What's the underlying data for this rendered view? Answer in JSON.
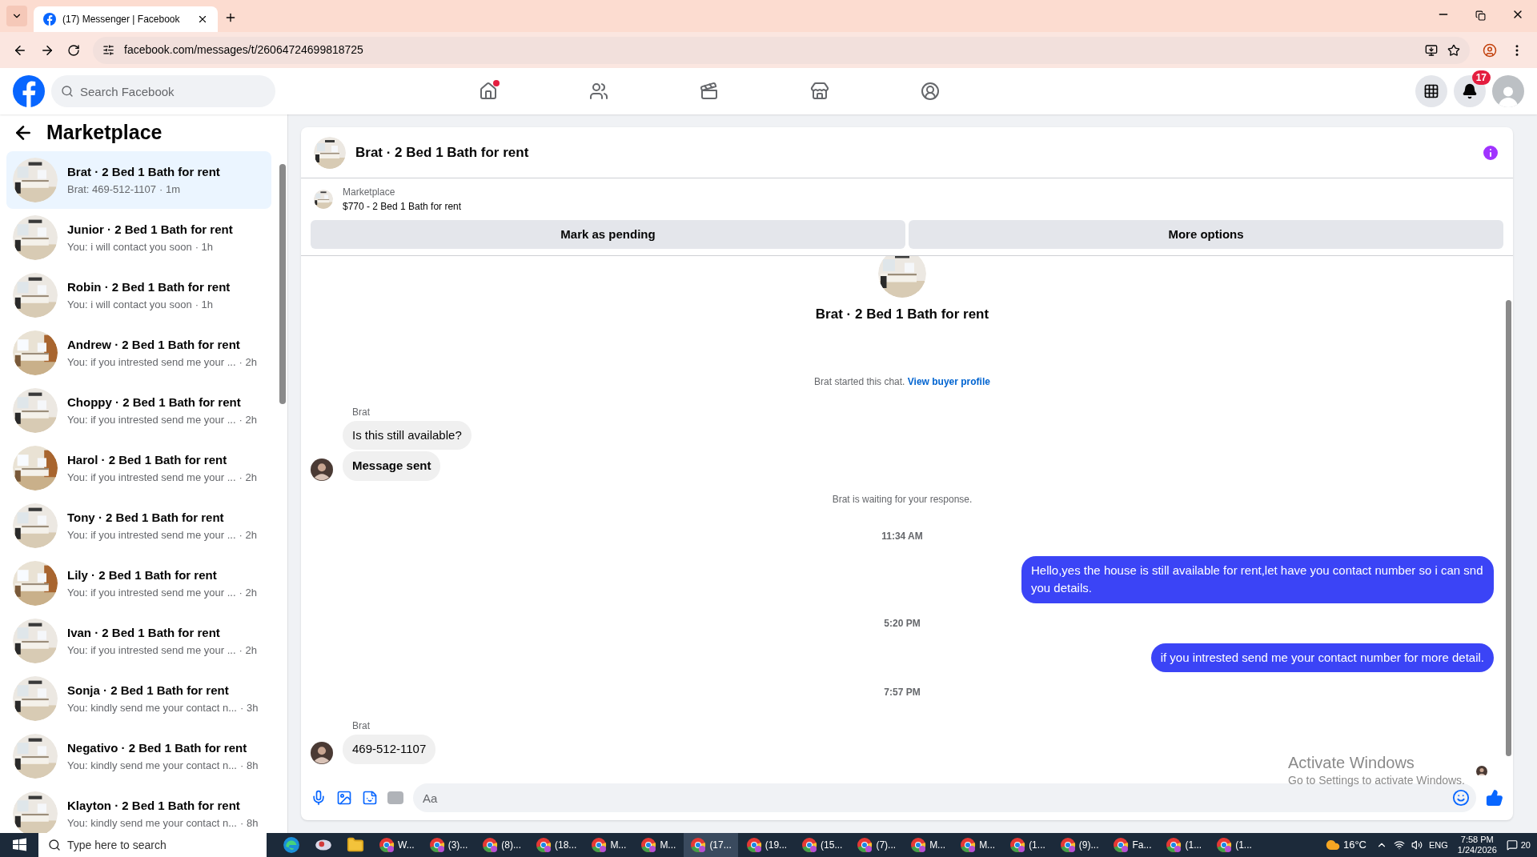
{
  "browser": {
    "tab_title": "(17) Messenger | Facebook",
    "url": "facebook.com/messages/t/26064724699818725"
  },
  "header": {
    "search_placeholder": "Search Facebook",
    "nav": [
      {
        "kind": "home",
        "dot": true
      },
      {
        "kind": "friends",
        "dot": false
      },
      {
        "kind": "video",
        "dot": false
      },
      {
        "kind": "marketplace",
        "dot": false
      },
      {
        "kind": "groups",
        "dot": false
      }
    ],
    "notification_count": "17"
  },
  "sidebar": {
    "title": "Marketplace",
    "conversations": [
      {
        "title": "Brat · 2 Bed 1 Bath for rent",
        "preview": "Brat: 469-512-1107",
        "time": "· 1m",
        "selected": true
      },
      {
        "title": "Junior · 2 Bed 1 Bath for rent",
        "preview": "You: i will contact you soon",
        "time": "· 1h",
        "selected": false
      },
      {
        "title": "Robin · 2 Bed 1 Bath for rent",
        "preview": "You: i will contact you soon",
        "time": "· 1h",
        "selected": false
      },
      {
        "title": "Andrew · 2 Bed 1 Bath for rent",
        "preview": "You: if you intrested send me your ...",
        "time": "· 2h",
        "selected": false
      },
      {
        "title": "Choppy · 2 Bed 1 Bath for rent",
        "preview": "You: if you intrested send me your ...",
        "time": "· 2h",
        "selected": false
      },
      {
        "title": "Harol · 2 Bed 1 Bath for rent",
        "preview": "You: if you intrested send me your ...",
        "time": "· 2h",
        "selected": false
      },
      {
        "title": "Tony · 2 Bed 1 Bath for rent",
        "preview": "You: if you intrested send me your ...",
        "time": "· 2h",
        "selected": false
      },
      {
        "title": "Lily · 2 Bed 1 Bath for rent",
        "preview": "You: if you intrested send me your ...",
        "time": "· 2h",
        "selected": false
      },
      {
        "title": "Ivan · 2 Bed 1 Bath for rent",
        "preview": "You: if you intrested send me your ...",
        "time": "· 2h",
        "selected": false
      },
      {
        "title": "Sonja · 2 Bed 1 Bath for rent",
        "preview": "You: kindly send me your contact n...",
        "time": "· 3h",
        "selected": false
      },
      {
        "title": "Negativo · 2 Bed 1 Bath for rent",
        "preview": "You: kindly send me your contact n...",
        "time": "· 8h",
        "selected": false
      },
      {
        "title": "Klayton · 2 Bed 1 Bath for rent",
        "preview": "You: kindly send me your contact n...",
        "time": "· 8h",
        "selected": false
      }
    ]
  },
  "chat": {
    "title": "Brat · 2 Bed 1 Bath for rent",
    "listing": {
      "label": "Marketplace",
      "text": "$770 - 2 Bed 1 Bath for rent"
    },
    "buttons": [
      "Mark as pending",
      "More options"
    ],
    "messages": [
      {
        "kind": "profile",
        "text": "Brat · 2 Bed 1 Bath for rent"
      },
      {
        "kind": "system",
        "text": "Brat started this chat.",
        "link": "View buyer profile"
      },
      {
        "kind": "sender",
        "text": "Brat"
      },
      {
        "kind": "incoming",
        "text": "Is this still available?",
        "avatar": false,
        "bold": false
      },
      {
        "kind": "incoming",
        "text": "Message sent",
        "avatar": true,
        "bold": true
      },
      {
        "kind": "system",
        "text": "Brat is waiting for your response."
      },
      {
        "kind": "time",
        "text": "11:34 AM"
      },
      {
        "kind": "outgoing",
        "text": "Hello,yes the house is still available for rent,let have you contact number so i can snd you details."
      },
      {
        "kind": "time",
        "text": "5:20 PM"
      },
      {
        "kind": "outgoing",
        "text": "if you intrested send me your contact number for more detail."
      },
      {
        "kind": "time",
        "text": "7:57 PM"
      },
      {
        "kind": "sender",
        "text": "Brat"
      },
      {
        "kind": "incoming",
        "text": "469-512-1107",
        "avatar": true,
        "bold": false
      }
    ],
    "composer_placeholder": "Aa"
  },
  "os_overlay": {
    "title": "Activate Windows",
    "subtitle": "Go to Settings to activate Windows."
  },
  "taskbar": {
    "search_placeholder": "Type here to search",
    "apps": [
      {
        "kind": "edge",
        "selected": false
      },
      {
        "kind": "tool",
        "selected": false
      },
      {
        "kind": "folder",
        "selected": false
      },
      {
        "kind": "chrome",
        "label": "W...",
        "selected": false
      },
      {
        "kind": "chrome",
        "label": "(3)...",
        "selected": false
      },
      {
        "kind": "chrome",
        "label": "(8)...",
        "selected": false
      },
      {
        "kind": "chrome",
        "label": "(18...",
        "selected": false
      },
      {
        "kind": "chrome",
        "label": "M...",
        "selected": false
      },
      {
        "kind": "chrome",
        "label": "M...",
        "selected": false
      },
      {
        "kind": "chrome",
        "label": "(17...",
        "selected": true
      },
      {
        "kind": "chrome",
        "label": "(19...",
        "selected": false
      },
      {
        "kind": "chrome",
        "label": "(15...",
        "selected": false
      },
      {
        "kind": "chrome",
        "label": "(7)...",
        "selected": false
      },
      {
        "kind": "chrome",
        "label": "M...",
        "selected": false
      },
      {
        "kind": "chrome",
        "label": "M...",
        "selected": false
      },
      {
        "kind": "chrome",
        "label": "(1...",
        "selected": false
      },
      {
        "kind": "chrome",
        "label": "(9)...",
        "selected": false
      },
      {
        "kind": "chrome",
        "label": "Fa...",
        "selected": false
      },
      {
        "kind": "chrome",
        "label": "(1...",
        "selected": false
      },
      {
        "kind": "chrome",
        "label": "(1...",
        "selected": false
      }
    ],
    "temperature": "16°C",
    "language": "ENG",
    "time": "7:58 PM",
    "date": "1/24/2026",
    "notifications": "20"
  }
}
